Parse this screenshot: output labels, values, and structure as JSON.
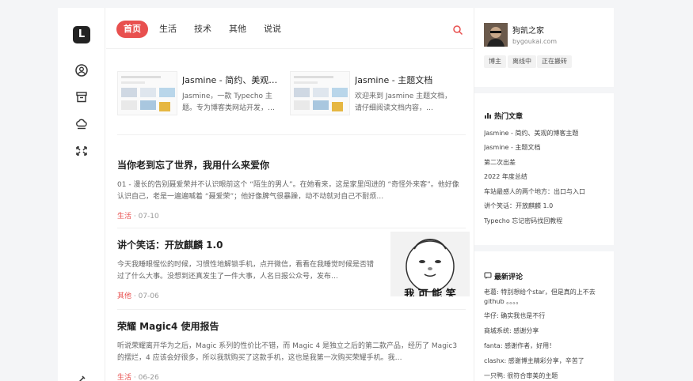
{
  "logo": {
    "letter": "L"
  },
  "nav": {
    "items": [
      {
        "label": "首页",
        "active": true
      },
      {
        "label": "生活"
      },
      {
        "label": "技术"
      },
      {
        "label": "其他"
      },
      {
        "label": "说说"
      }
    ]
  },
  "featured": [
    {
      "title": "Jasmine - 简约、美观的…",
      "desc": "Jasmine，一款 Typecho 主题。专为博客类网站开发，…"
    },
    {
      "title": "Jasmine - 主题文档",
      "desc": "欢迎来到 Jasmine 主题文档，请仔细阅读文档内容，…"
    }
  ],
  "posts": [
    {
      "title": "当你老到忘了世界，我用什么来爱你",
      "excerpt": "01 - 漫长的告别聂爱荣并不认识眼前这个 “陌生的男人”。在她看来，这是家里闯进的 “奇怪外来客”。他好像认识自己，老是一遍遍喊着 “聂爱荣”；他好像脾气很暴躁，动不动就对自己不耐烦…",
      "category": "生活",
      "date": " · 07-10"
    },
    {
      "title": "讲个笑话：开放麒麟 1.0",
      "excerpt": "今天我睡眼惺忪的时候，习惯性地解锁手机，点开微信，看看在我睡觉时候是否错过了什么大事。没想到还真发生了一件大事，人名日报公众号，发布…",
      "category": "其他",
      "date": " · 07-06",
      "image_caption": "我 可 能 笑"
    },
    {
      "title": "荣耀 Magic4 使用报告",
      "excerpt": "听说荣耀离开华为之后，Magic 系列的性价比不错，而 Magic 4 是独立之后的第二款产品，经历了 Magic3 的摆烂，4 应该会好很多，所以我就购买了这款手机，这也是我第一次购买荣耀手机。我…",
      "category": "生活",
      "date": " · 06-26"
    }
  ],
  "profile": {
    "name": "狗凯之家",
    "url": "bygoukai.com",
    "tags": [
      "博主",
      "离线中",
      "正在搬砖"
    ]
  },
  "hot": {
    "heading": "热门文章",
    "items": [
      "Jasmine - 简约、美观的博客主题",
      "Jasmine - 主题文档",
      "第二次出差",
      "2022 年度总结",
      "车站最感人的两个地方：出口与入口",
      "讲个笑话：开放麒麟 1.0",
      "Typecho 忘记密码找回教程"
    ]
  },
  "comments": {
    "heading": "最新评论",
    "items": [
      "老葛: 特别想给个star，但是真的上不去github 。。。。",
      "华仔: 确实我也是不行",
      "商城系统: 感谢分享",
      "fanta: 感谢作者，好用！",
      "clashx: 感谢博主精彩分享，辛苦了",
      "一只鸭: 很符合审美的主题"
    ]
  },
  "colors": {
    "accent": "#e8504f",
    "background": "#f4f5f7"
  },
  "icons": [
    "user-circle-icon",
    "archive-icon",
    "cloud-icon",
    "shuffle-icon",
    "search-icon",
    "brush-icon",
    "chart-icon",
    "comment-icon"
  ]
}
